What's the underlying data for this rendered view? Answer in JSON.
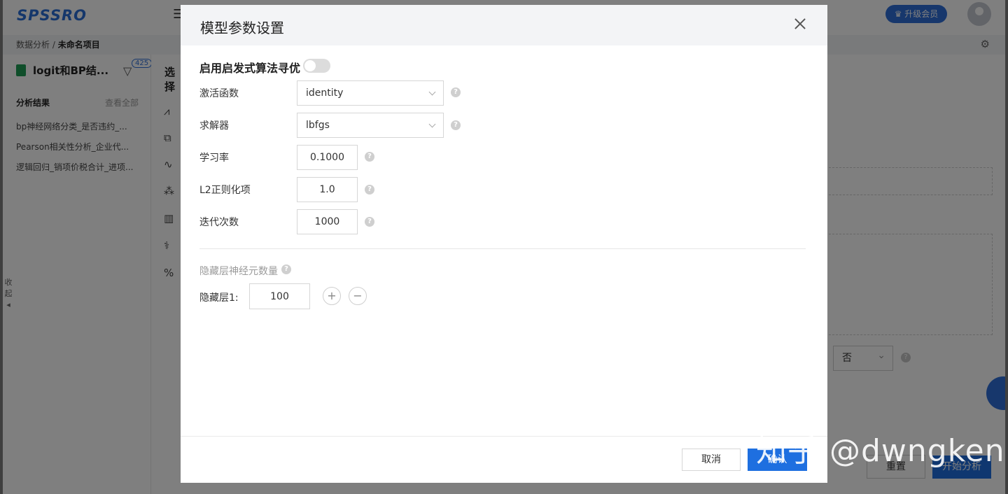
{
  "app": {
    "logo": "SPSSRO",
    "upgrade_label": "升级会员",
    "breadcrumb_root": "数据分析",
    "breadcrumb_sep": "/",
    "breadcrumb_current": "未命名项目",
    "file_name": "logit和BP结...",
    "filter_badge": "425",
    "results_title": "分析结果",
    "view_all": "查看全部",
    "results": [
      "bp神经网络分类_是否违约_...",
      "Pearson相关性分析_企业代...",
      "逻辑回归_销项价税合计_进项..."
    ],
    "collapse_label": "收起",
    "select_label": "选择",
    "no_value": "否",
    "reset_label": "重置",
    "start_label": "开始分析"
  },
  "modal": {
    "title": "模型参数设置",
    "heuristic_label": "启用启发式算法寻优",
    "heuristic_enabled": false,
    "activation_label": "激活函数",
    "activation_value": "identity",
    "solver_label": "求解器",
    "solver_value": "lbfgs",
    "lr_label": "学习率",
    "lr_value": "0.1000",
    "l2_label": "L2正则化项",
    "l2_value": "1.0",
    "iter_label": "迭代次数",
    "iter_value": "1000",
    "hidden_title": "隐藏层神经元数量",
    "layer1_label": "隐藏层1:",
    "layer1_value": "100",
    "add_symbol": "+",
    "remove_symbol": "−",
    "cancel_label": "取消",
    "confirm_label": "确认"
  },
  "watermark": "知乎 @dwngken",
  "colors": {
    "primary": "#1e6fe0",
    "overlay": "rgba(0,0,0,0.5)"
  }
}
